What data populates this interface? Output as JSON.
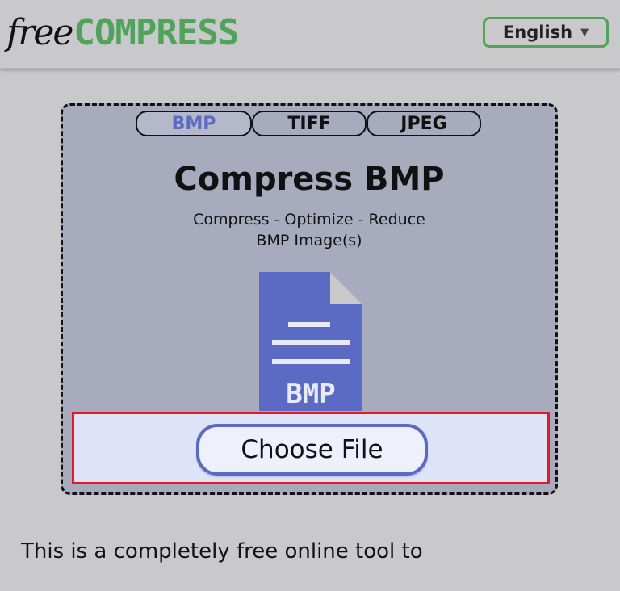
{
  "header": {
    "logo_free": "free",
    "logo_compress": "COMPRESS",
    "language_label": "English"
  },
  "tabs": [
    {
      "label": "BMP",
      "active": true
    },
    {
      "label": "TIFF",
      "active": false
    },
    {
      "label": "JPEG",
      "active": false
    }
  ],
  "main": {
    "title": "Compress BMP",
    "subtitle_line1": "Compress - Optimize - Reduce",
    "subtitle_line2": "BMP Image(s)",
    "file_icon_text": "BMP",
    "choose_file_label": "Choose File",
    "intro_text": "This is a completely free online tool to"
  },
  "colors": {
    "brand_green": "#4fa35a",
    "accent_blue": "#5b6bc4",
    "highlight_red": "#e21b23"
  },
  "icons": {
    "file": "file-icon",
    "caret": "chevron-down-icon"
  }
}
